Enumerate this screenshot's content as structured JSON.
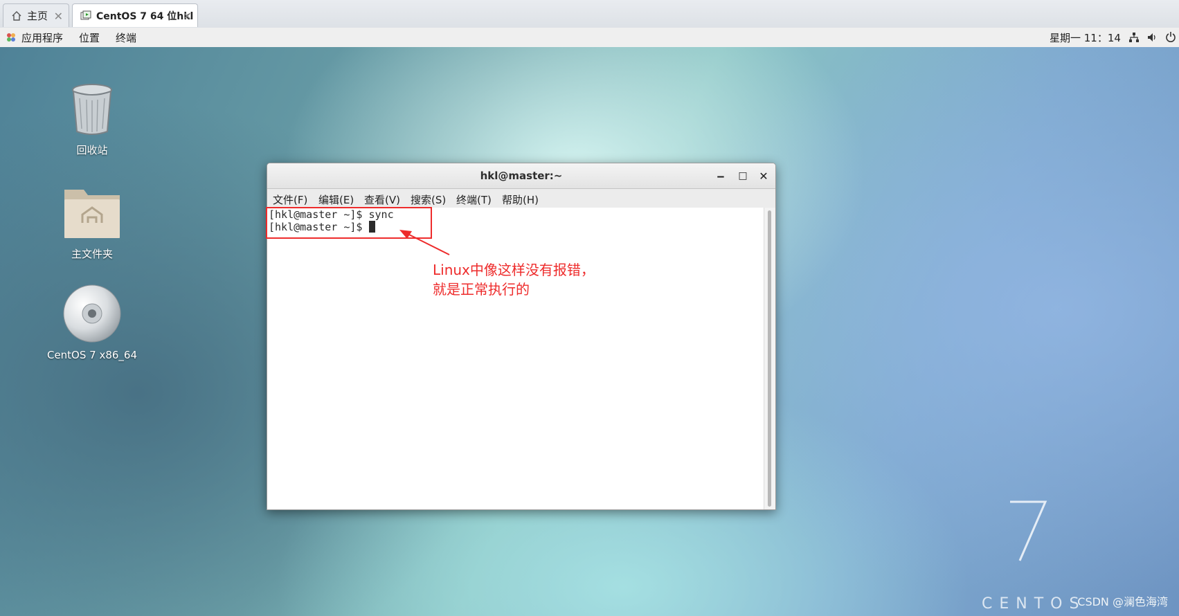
{
  "vmware_tabs": [
    {
      "label": "主页",
      "icon": "home-icon",
      "close": "✕"
    },
    {
      "label": "CentOS 7 64 位hkl",
      "icon": "vm-icon",
      "close": "✕"
    }
  ],
  "topbar": {
    "apps_label": "应用程序",
    "places_label": "位置",
    "terminal_label": "终端",
    "clock": "星期一 11：14",
    "network_icon": "network-icon",
    "volume_icon": "volume-icon",
    "power_icon": "power-icon"
  },
  "desktop": {
    "icons": [
      {
        "label": "回收站",
        "icon": "trash-icon"
      },
      {
        "label": "主文件夹",
        "icon": "home-folder-icon"
      },
      {
        "label": "CentOS 7 x86_64",
        "icon": "disc-icon"
      }
    ],
    "wallpaper_text": "CENTOS",
    "wallpaper_number": "7"
  },
  "terminal": {
    "title": "hkl@master:~",
    "minimize": "‒",
    "maximize": "□",
    "close": "✕",
    "menu": [
      "文件(F)",
      "编辑(E)",
      "查看(V)",
      "搜索(S)",
      "终端(T)",
      "帮助(H)"
    ],
    "lines": [
      "[hkl@master ~]$ sync",
      "[hkl@master ~]$ "
    ]
  },
  "annotation": {
    "line1": "Linux中像这样没有报错，",
    "line2": "就是正常执行的",
    "color": "#ee2b2b"
  },
  "watermark": "CSDN @澜色海湾"
}
